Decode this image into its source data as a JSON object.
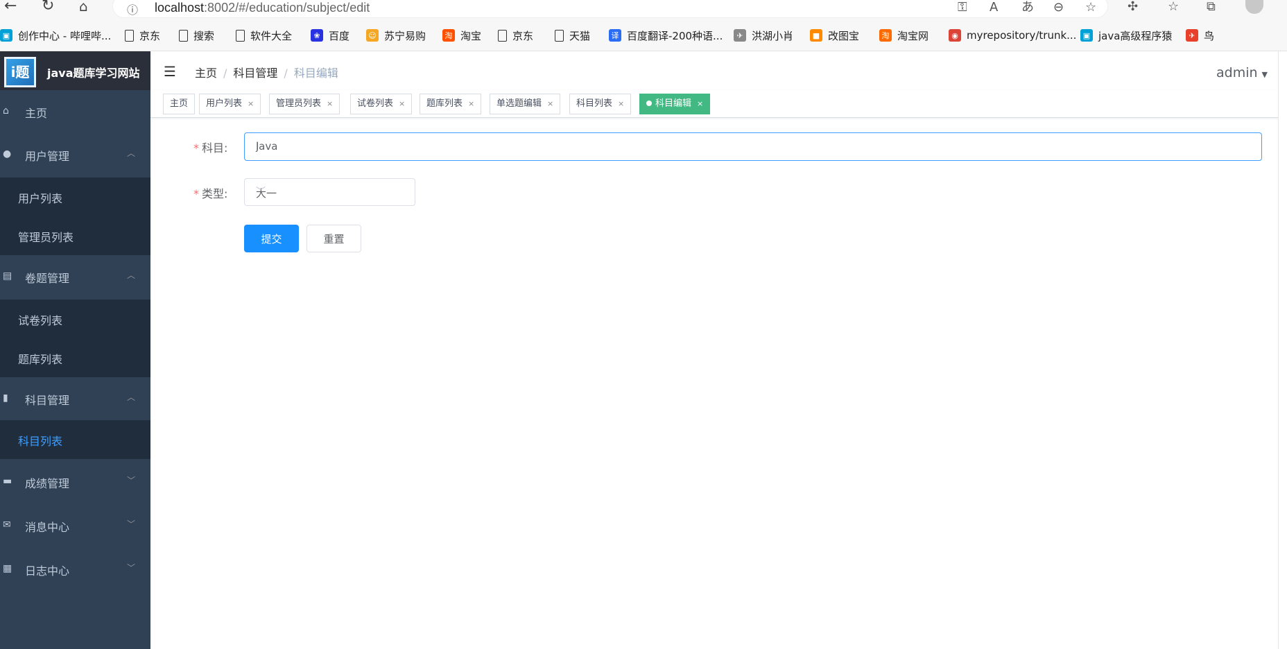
{
  "browser": {
    "url_host": "localhost",
    "url_rest": ":8002/#/education/subject/edit",
    "bookmarks": [
      {
        "label": "创作中心 - 哔哩哔...",
        "icon": "bilibili-icon",
        "color": "#00a1d6"
      },
      {
        "label": "京东",
        "icon": "page-icon",
        "color": ""
      },
      {
        "label": "搜索",
        "icon": "page-icon",
        "color": ""
      },
      {
        "label": "软件大全",
        "icon": "page-icon",
        "color": ""
      },
      {
        "label": "百度",
        "icon": "baidu-icon",
        "color": "#2932e1"
      },
      {
        "label": "苏宁易购",
        "icon": "suning-icon",
        "color": "#f5a623"
      },
      {
        "label": "淘宝",
        "icon": "taobao-icon",
        "color": "#ff5000"
      },
      {
        "label": "京东",
        "icon": "page-icon",
        "color": ""
      },
      {
        "label": "天猫",
        "icon": "page-icon",
        "color": ""
      },
      {
        "label": "百度翻译-200种语...",
        "icon": "baidu-translate-icon",
        "color": "#2a6cf5"
      },
      {
        "label": "洪湖小肖",
        "icon": "bird-icon",
        "color": "#888888"
      },
      {
        "label": "改图宝",
        "icon": "gaitubao-icon",
        "color": "#ff8a00"
      },
      {
        "label": "淘宝网",
        "icon": "taobao-icon",
        "color": "#ff6a00"
      },
      {
        "label": "myrepository/trunk...",
        "icon": "chrome-icon",
        "color": "#db4437"
      },
      {
        "label": "java高级程序猿",
        "icon": "bilibili-icon",
        "color": "#00a1d6"
      },
      {
        "label": "鸟",
        "icon": "bird-icon",
        "color": "#e8402a"
      }
    ]
  },
  "sidebar": {
    "site_title": "java题库学习网站",
    "logo_text": "i题",
    "menu": [
      {
        "label": "主页",
        "icon": "home-icon"
      },
      {
        "label": "用户管理",
        "icon": "user-icon"
      },
      {
        "label": "卷题管理",
        "icon": "document-icon"
      },
      {
        "label": "科目管理",
        "icon": "book-icon"
      },
      {
        "label": "成绩管理",
        "icon": "chat-icon"
      },
      {
        "label": "消息中心",
        "icon": "mail-icon"
      },
      {
        "label": "日志中心",
        "icon": "log-icon"
      }
    ],
    "sub_user": [
      "用户列表",
      "管理员列表"
    ],
    "sub_exam": [
      "试卷列表",
      "题库列表"
    ],
    "sub_subject": [
      "科目列表"
    ]
  },
  "header": {
    "breadcrumb": [
      "主页",
      "科目管理",
      "科目编辑"
    ],
    "user": "admin"
  },
  "tags": [
    "主页",
    "用户列表",
    "管理员列表",
    "试卷列表",
    "题库列表",
    "单选题编辑",
    "科目列表",
    "科目编辑"
  ],
  "form": {
    "subject_label": "科目:",
    "subject_value": "java",
    "type_label": "类型:",
    "type_value": "大一",
    "submit_label": "提交",
    "reset_label": "重置"
  },
  "colors": {
    "sidebar_bg": "#304156",
    "active_tag": "#42b983",
    "primary": "#1890ff",
    "active_menu_text": "#409eff"
  }
}
